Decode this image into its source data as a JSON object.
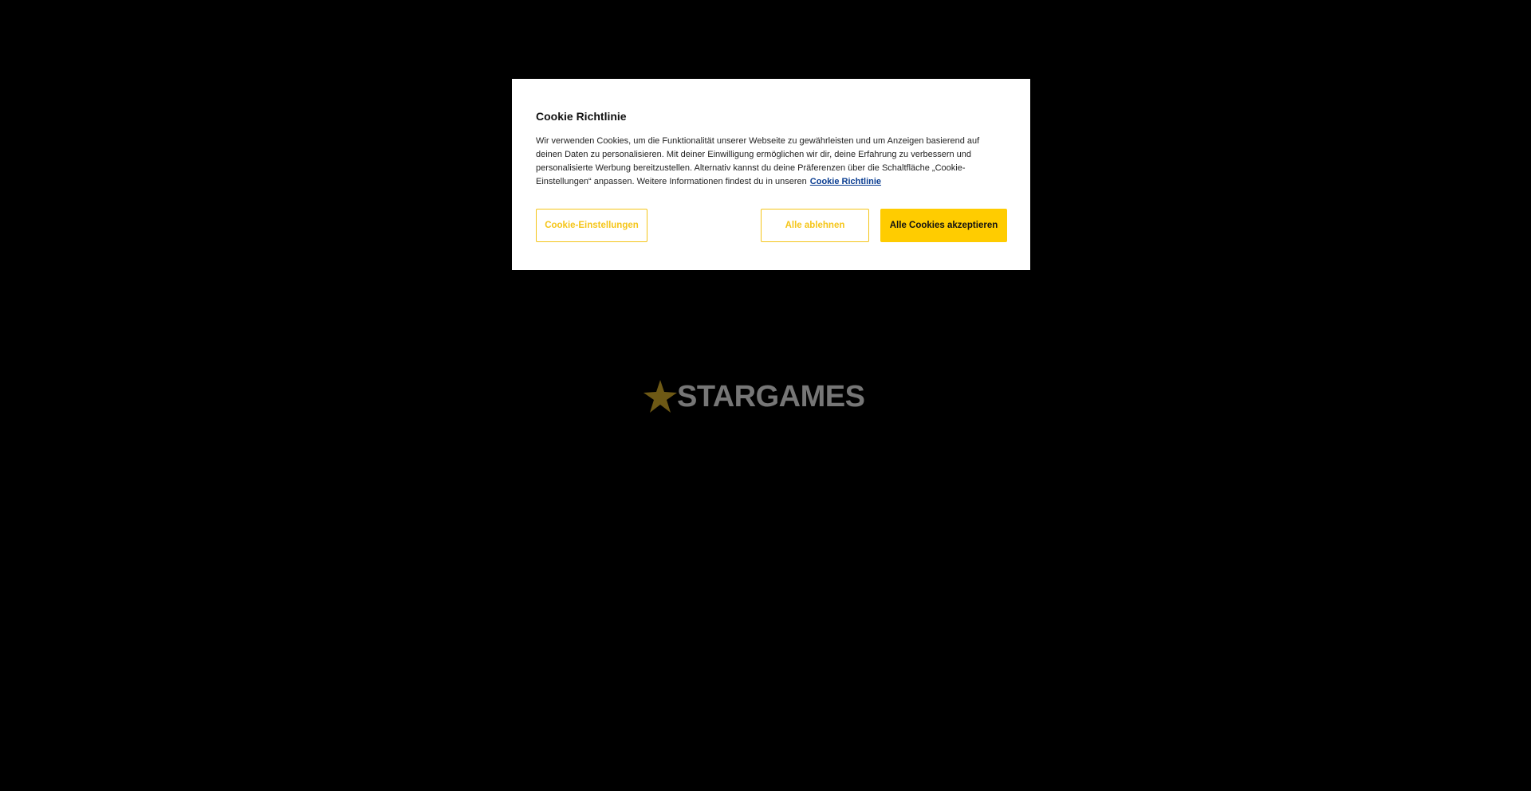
{
  "logo": {
    "text": "STARGAMES",
    "icon": "star-icon",
    "colors": {
      "star": "#c9a227",
      "text": "#d8d8d8"
    }
  },
  "cookie_dialog": {
    "title": "Cookie Richtlinie",
    "body": "Wir verwenden Cookies, um die Funktionalität unserer Webseite zu gewährleisten und um Anzeigen basierend auf deinen Daten zu personalisieren. Mit deiner Einwilligung ermöglichen wir dir, deine Erfahrung zu verbessern und personalisierte Werbung bereitzustellen. Alternativ kannst du deine Präferenzen über die Schaltfläche „Cookie-Einstellungen“ anpassen. Weitere Informationen findest du in unseren",
    "link_label": "Cookie Richtlinie",
    "buttons": {
      "settings": "Cookie-Einstellungen",
      "reject": "Alle ablehnen",
      "accept": "Alle Cookies akzeptieren"
    },
    "colors": {
      "accent": "#ffcc00",
      "link": "#0a3d91",
      "background": "#ffffff"
    }
  },
  "page": {
    "background": "#000000"
  }
}
